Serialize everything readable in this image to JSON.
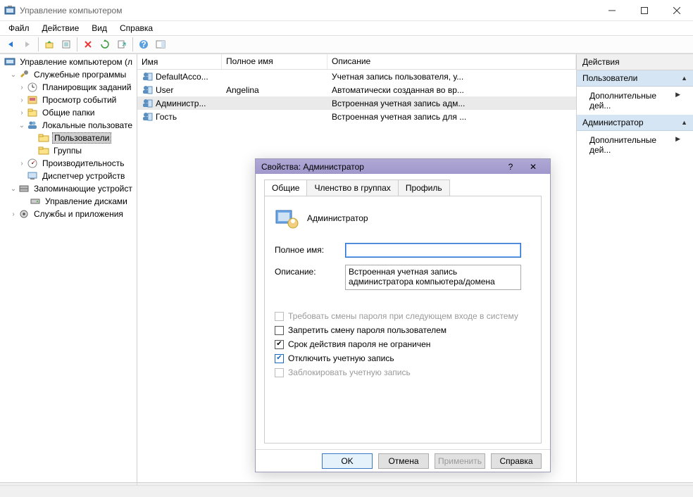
{
  "window": {
    "title": "Управление компьютером"
  },
  "menu": {
    "file": "Файл",
    "action": "Действие",
    "view": "Вид",
    "help": "Справка"
  },
  "tree": {
    "root": "Управление компьютером (л",
    "sys": "Служебные программы",
    "scheduler": "Планировщик заданий",
    "events": "Просмотр событий",
    "shared": "Общие папки",
    "localusers": "Локальные пользовате",
    "users": "Пользователи",
    "groups": "Группы",
    "perf": "Производительность",
    "devmgr": "Диспетчер устройств",
    "storage": "Запоминающие устройст",
    "diskmgr": "Управление дисками",
    "services": "Службы и приложения"
  },
  "list": {
    "col_name": "Имя",
    "col_full": "Полное имя",
    "col_desc": "Описание",
    "rows": [
      {
        "name": "DefaultAcco...",
        "full": "",
        "desc": "Учетная запись пользователя, у..."
      },
      {
        "name": "User",
        "full": "Angelina",
        "desc": "Автоматически созданная во вр..."
      },
      {
        "name": "Администр...",
        "full": "",
        "desc": "Встроенная учетная запись адм..."
      },
      {
        "name": "Гость",
        "full": "",
        "desc": "Встроенная учетная запись для ..."
      }
    ]
  },
  "actions": {
    "header": "Действия",
    "group1": "Пользователи",
    "link": "Дополнительные дей...",
    "group2": "Администратор"
  },
  "dialog": {
    "title": "Свойства: Администратор",
    "tab_general": "Общие",
    "tab_member": "Членство в группах",
    "tab_profile": "Профиль",
    "user": "Администратор",
    "lbl_fullname": "Полное имя:",
    "val_fullname": "",
    "lbl_desc": "Описание:",
    "val_desc": "Встроенная учетная запись администратора компьютера/домена",
    "require_change": "Требовать смены пароля при следующем входе в систему",
    "no_change": "Запретить смену пароля пользователем",
    "never_expire": "Срок действия пароля не ограничен",
    "disable": "Отключить учетную запись",
    "locked": "Заблокировать учетную запись",
    "ok": "OK",
    "cancel": "Отмена",
    "apply": "Применить",
    "help": "Справка"
  }
}
